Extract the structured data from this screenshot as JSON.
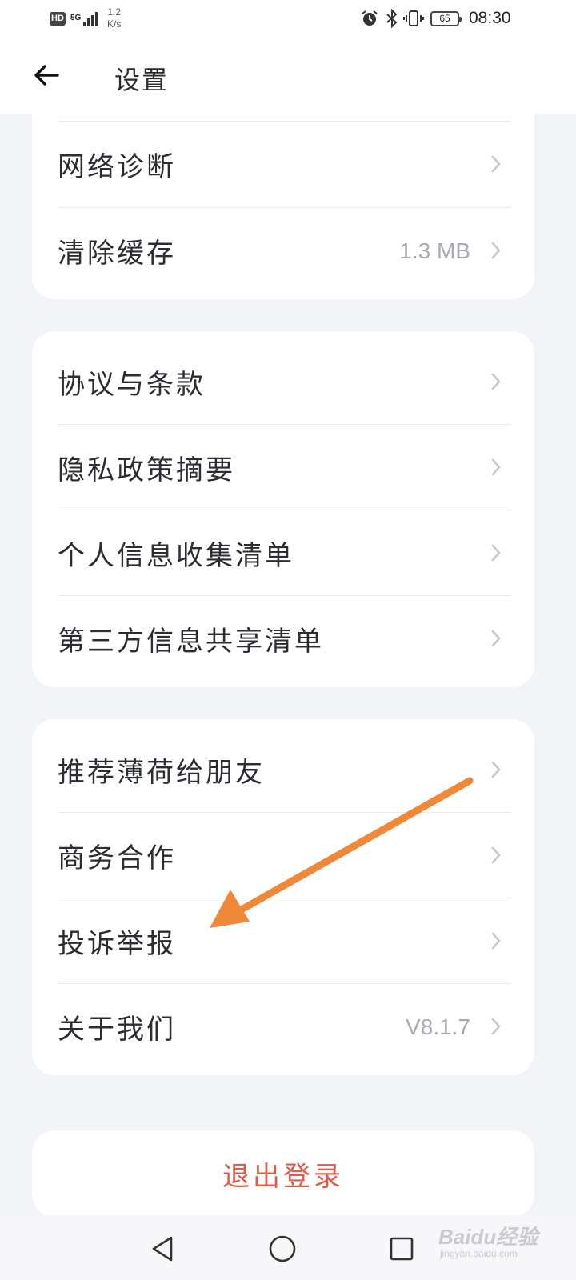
{
  "status_bar": {
    "hd": "HD",
    "network": "5G",
    "speed_value": "1.2",
    "speed_unit": "K/s",
    "battery": "65",
    "time": "08:30",
    "icons": [
      "alarm-icon",
      "bluetooth-icon",
      "vibrate-icon",
      "battery-icon"
    ]
  },
  "app_bar": {
    "title": "设置",
    "back_icon": "arrow-left-icon"
  },
  "cards": {
    "network": [
      {
        "label": "网络诊断",
        "value": ""
      },
      {
        "label": "清除缓存",
        "value": "1.3 MB"
      }
    ],
    "legal": [
      {
        "label": "协议与条款",
        "value": ""
      },
      {
        "label": "隐私政策摘要",
        "value": ""
      },
      {
        "label": "个人信息收集清单",
        "value": ""
      },
      {
        "label": "第三方信息共享清单",
        "value": ""
      }
    ],
    "about": [
      {
        "label": "推荐薄荷给朋友",
        "value": ""
      },
      {
        "label": "商务合作",
        "value": ""
      },
      {
        "label": "投诉举报",
        "value": ""
      },
      {
        "label": "关于我们",
        "value": "V8.1.7"
      }
    ]
  },
  "logout_label": "退出登录",
  "nav_bar": {
    "icons": [
      "back-triangle-icon",
      "home-circle-icon",
      "recents-square-icon"
    ]
  },
  "watermark": {
    "main": "Baidu经验",
    "sub": "jingyan.baidu.com"
  },
  "annotation_arrow": {
    "color": "#f0883a",
    "points_to": "投诉举报"
  },
  "colors": {
    "background": "#f3f4f8",
    "card": "#ffffff",
    "logout": "#e05a4c",
    "secondary_text": "#a8aab2"
  }
}
